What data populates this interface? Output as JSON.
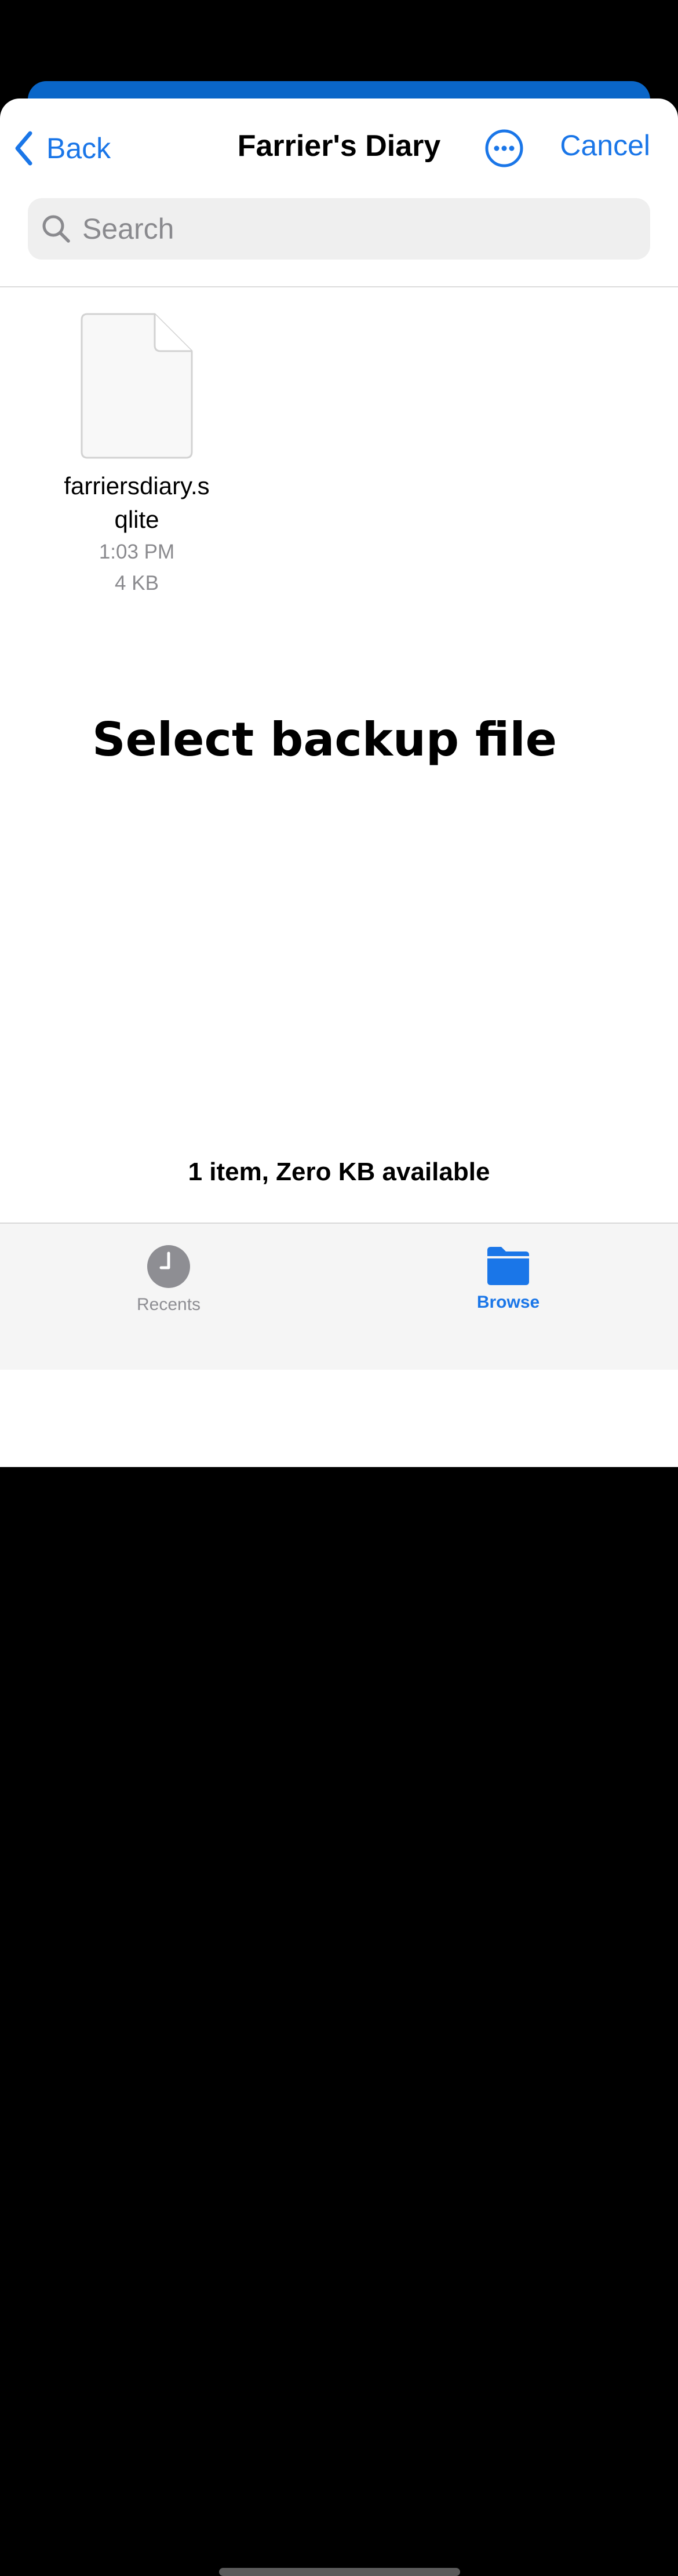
{
  "nav": {
    "back_label": "Back",
    "title": "Farrier's Diary",
    "more_icon": "ellipsis-circle-icon",
    "cancel_label": "Cancel"
  },
  "search": {
    "placeholder": "Search",
    "value": ""
  },
  "files": [
    {
      "name": "farriersdiary.sqlite",
      "time": "1:03 PM",
      "size": "4 KB",
      "icon": "document-icon"
    }
  ],
  "overlay_title": "Select backup file",
  "status": "1 item, Zero KB available",
  "tabbar": {
    "recents_label": "Recents",
    "browse_label": "Browse",
    "recents_icon": "clock-icon",
    "browse_icon": "folder-icon",
    "selected": "Browse"
  },
  "colors": {
    "accent": "#1a76e8",
    "sheet_bg": "#ffffff",
    "tabbar_bg": "#f5f5f5",
    "backdrop_bar": "#0a66c8"
  }
}
